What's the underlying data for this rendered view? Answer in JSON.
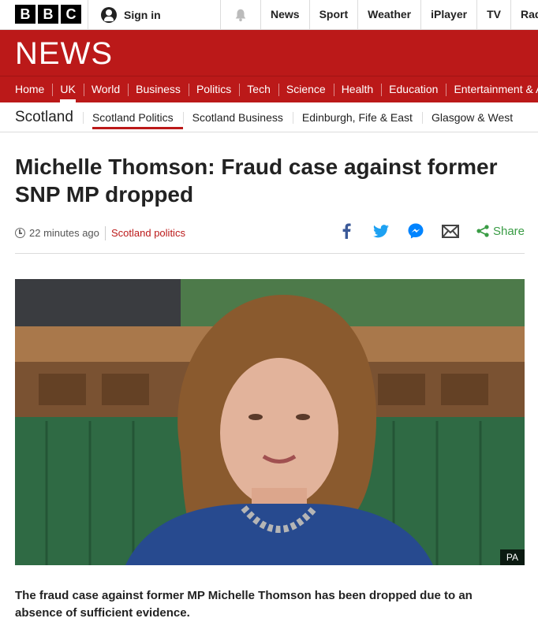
{
  "topbar": {
    "brand": [
      "B",
      "B",
      "C"
    ],
    "signin_label": "Sign in",
    "nav": [
      "News",
      "Sport",
      "Weather",
      "iPlayer",
      "TV",
      "Radio"
    ]
  },
  "banner": {
    "wordmark": "NEWS"
  },
  "mainnav": {
    "items": [
      "Home",
      "UK",
      "World",
      "Business",
      "Politics",
      "Tech",
      "Science",
      "Health",
      "Education",
      "Entertainment & Arts"
    ],
    "active": "UK"
  },
  "sectionnav": {
    "title": "Scotland",
    "links": [
      "Scotland Politics",
      "Scotland Business",
      "Edinburgh, Fife & East",
      "Glasgow & West"
    ],
    "active": "Scotland Politics"
  },
  "article": {
    "headline": "Michelle Thomson: Fraud case against former SNP MP dropped",
    "timestamp": "22 minutes ago",
    "tag": "Scotland politics",
    "share_label": "Share",
    "image_credit": "PA",
    "summary": "The fraud case against former MP Michelle Thomson has been dropped due to an absence of sufficient evidence."
  },
  "colors": {
    "brand_red": "#bb1919",
    "facebook": "#3b5998",
    "twitter": "#1da1f2",
    "messenger": "#0084ff",
    "share_green": "#3a9c45"
  },
  "icons": [
    "user-icon",
    "bell-icon",
    "clock-icon",
    "facebook-icon",
    "twitter-icon",
    "messenger-icon",
    "email-icon",
    "share-icon"
  ]
}
